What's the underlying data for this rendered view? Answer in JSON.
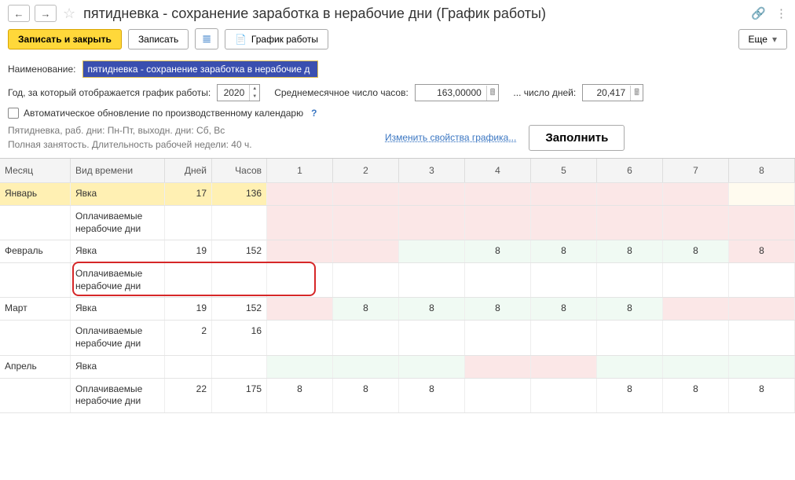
{
  "header": {
    "title": "пятидневка - сохранение заработка в нерабочие дни (График работы)"
  },
  "toolbar": {
    "save_close": "Записать и закрыть",
    "save": "Записать",
    "schedule": "График работы",
    "more": "Еще"
  },
  "fields": {
    "name_label": "Наименование:",
    "name_value": "пятидневка - сохранение заработка в нерабочие д",
    "year_label": "Год, за который отображается график работы:",
    "year_value": "2020",
    "avg_hours_label": "Среднемесячное число часов:",
    "avg_hours_value": "163,00000",
    "avg_days_label": "... число дней:",
    "avg_days_value": "20,417",
    "auto_update": "Автоматическое обновление по производственному календарю"
  },
  "description": {
    "line1": "Пятидневка, раб. дни: Пн-Пт, выходн. дни: Сб, Вс",
    "line2": "Полная занятость. Длительность рабочей недели: 40 ч.",
    "change_link": "Изменить свойства графика...",
    "fill_btn": "Заполнить"
  },
  "columns": {
    "month": "Месяц",
    "time_type": "Вид времени",
    "days": "Дней",
    "hours": "Часов",
    "d1": "1",
    "d2": "2",
    "d3": "3",
    "d4": "4",
    "d5": "5",
    "d6": "6",
    "d7": "7",
    "d8": "8"
  },
  "rows": [
    {
      "month": "Январь",
      "type": "Явка",
      "days": "17",
      "hours": "136",
      "cells": [
        "",
        "",
        "",
        "",
        "",
        "",
        "",
        ""
      ],
      "tone": [
        "pink",
        "pink",
        "pink",
        "pink",
        "pink",
        "pink",
        "pink",
        "cream"
      ],
      "hl": "yellow"
    },
    {
      "month": "",
      "type": "Оплачиваемые нерабочие дни",
      "days": "",
      "hours": "",
      "cells": [
        "",
        "",
        "",
        "",
        "",
        "",
        "",
        ""
      ],
      "tone": [
        "pink",
        "pink",
        "pink",
        "pink",
        "pink",
        "pink",
        "pink",
        "pink"
      ],
      "tall": true
    },
    {
      "month": "Февраль",
      "type": "Явка",
      "days": "19",
      "hours": "152",
      "cells": [
        "",
        "",
        "",
        "8",
        "8",
        "8",
        "8",
        "8"
      ],
      "tone": [
        "pink",
        "pink",
        "mint",
        "mint",
        "mint",
        "mint",
        "mint",
        "pink"
      ]
    },
    {
      "month": "",
      "type": "Оплачиваемые нерабочие дни",
      "days": "",
      "hours": "",
      "cells": [
        "",
        "",
        "",
        "",
        "",
        "",
        "",
        ""
      ],
      "tone": [
        "",
        "",
        "",
        "",
        "",
        "",
        "",
        ""
      ],
      "tall": true,
      "outline": true
    },
    {
      "month": "Март",
      "type": "Явка",
      "days": "19",
      "hours": "152",
      "cells": [
        "",
        "8",
        "8",
        "8",
        "8",
        "8",
        "",
        ""
      ],
      "tone": [
        "pink",
        "mint",
        "mint",
        "mint",
        "mint",
        "mint",
        "pink",
        "pink"
      ]
    },
    {
      "month": "",
      "type": "Оплачиваемые нерабочие дни",
      "days": "2",
      "hours": "16",
      "cells": [
        "",
        "",
        "",
        "",
        "",
        "",
        "",
        ""
      ],
      "tone": [
        "",
        "",
        "",
        "",
        "",
        "",
        "",
        ""
      ],
      "tall": true
    },
    {
      "month": "Апрель",
      "type": "Явка",
      "days": "",
      "hours": "",
      "cells": [
        "",
        "",
        "",
        "",
        "",
        "",
        "",
        ""
      ],
      "tone": [
        "mint",
        "mint",
        "mint",
        "pink",
        "pink",
        "mint",
        "mint",
        "mint"
      ]
    },
    {
      "month": "",
      "type": "Оплачиваемые нерабочие дни",
      "days": "22",
      "hours": "175",
      "cells": [
        "8",
        "8",
        "8",
        "",
        "",
        "8",
        "8",
        "8"
      ],
      "tone": [
        "",
        "",
        "",
        "",
        "",
        "",
        "",
        ""
      ],
      "tall": true
    }
  ]
}
